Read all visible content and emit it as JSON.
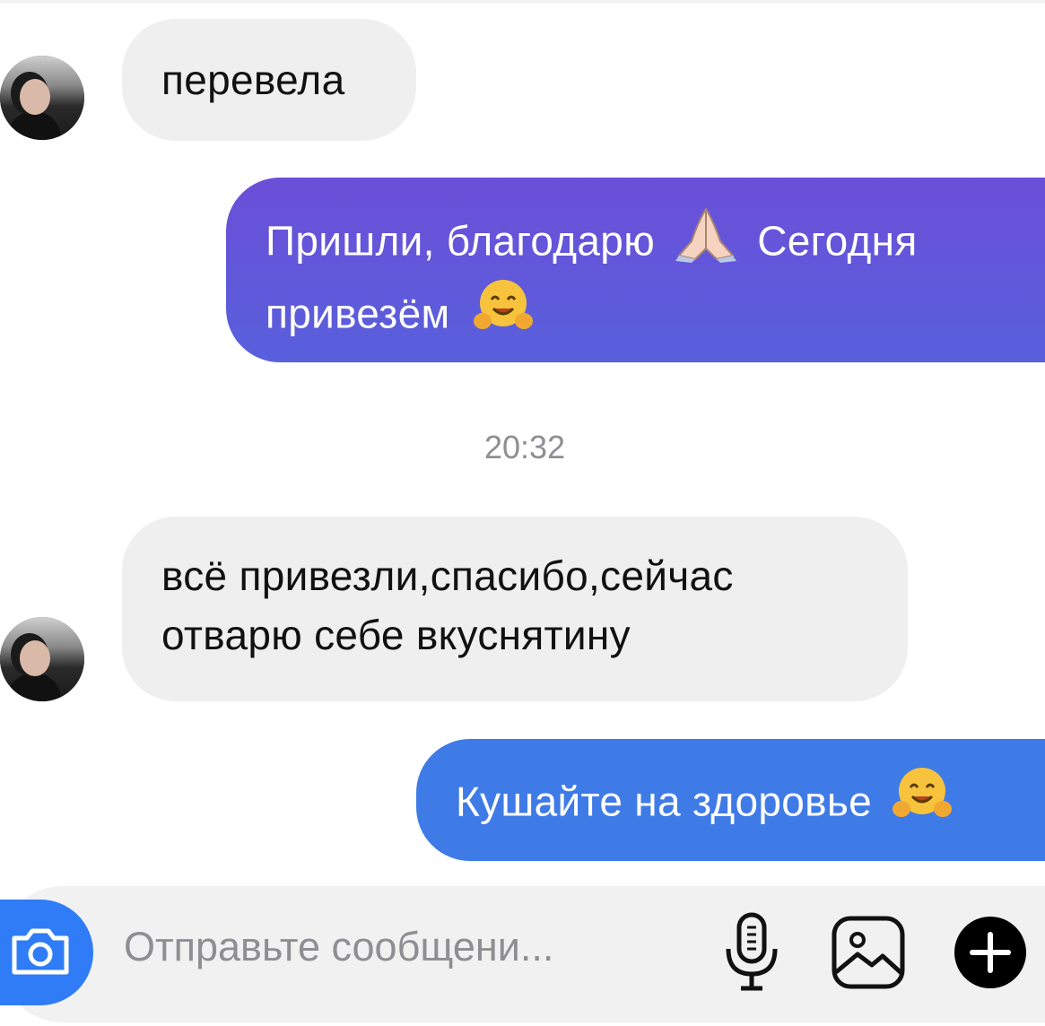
{
  "messages": [
    {
      "text": "перевела"
    },
    {
      "text": "Пришли, благодарю",
      "emoji_prayer": "🙏",
      "text2": "Сегодня",
      "text3": "привезём",
      "emoji_hug": "🤗"
    },
    {
      "text": "всё привезли,спасибо,сейчас",
      "text2": "отварю себе вкуснятину"
    },
    {
      "text": "Кушайте на здоровье",
      "emoji_hug": "🤗"
    }
  ],
  "timestamp": "20:32",
  "composer": {
    "placeholder": "Отправьте сообщени...",
    "icons": [
      "camera-icon",
      "microphone-icon",
      "image-icon",
      "plus-icon"
    ]
  },
  "colors": {
    "outgoing_gradient_top": "#6b4fd8",
    "outgoing_gradient_bottom": "#3f7be6",
    "incoming_bg": "#efeff0",
    "camera_button": "#2f7cf6"
  }
}
